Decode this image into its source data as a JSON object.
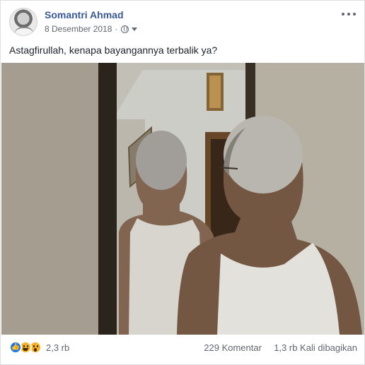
{
  "post": {
    "author": "Somantri Ahmad",
    "date": "8 Desember 2018",
    "separator": "·",
    "caption": "Astagfirullah, kenapa bayangannya terbalik ya?",
    "icons": {
      "privacy": "globe-icon",
      "privacy_menu": "caret-icon",
      "options": "more-icon"
    }
  },
  "footer": {
    "reactions": [
      "like",
      "haha",
      "wow"
    ],
    "reaction_count": "2,3 rb",
    "comments": "229 Komentar",
    "shares": "1,3 rb Kali dibagikan"
  },
  "colors": {
    "author_link": "#385898",
    "meta_text": "#616770",
    "like_blue": "#1877f2",
    "emoji_yellow": "#f7b125"
  }
}
